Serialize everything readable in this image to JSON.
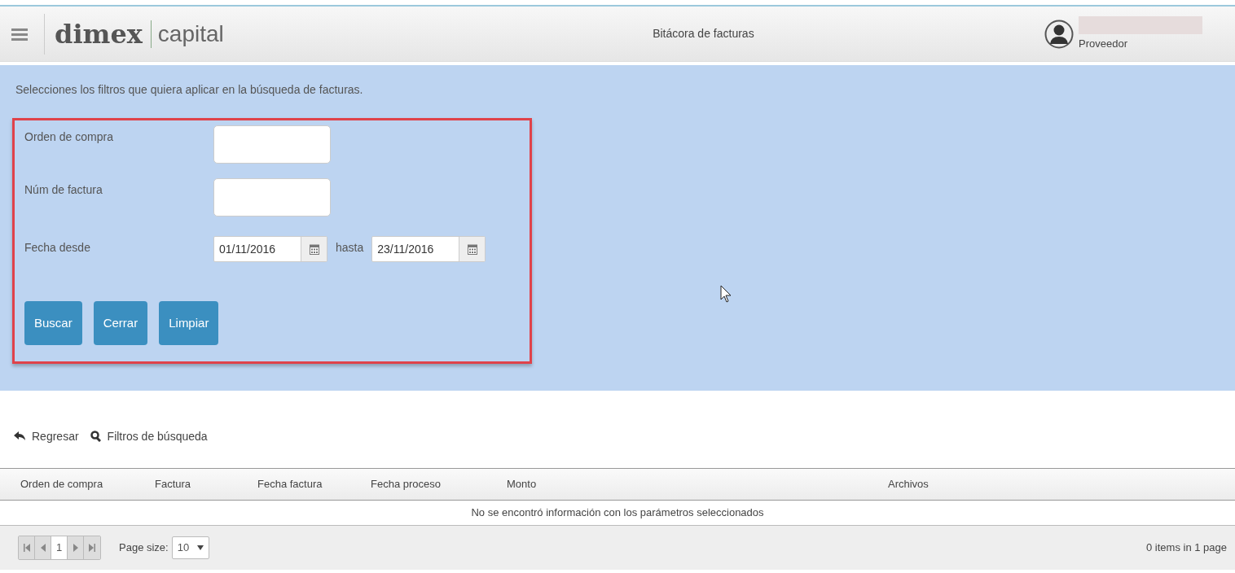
{
  "header": {
    "logo_bold": "dimex",
    "logo_light": "capital",
    "title": "Bitácora de facturas",
    "user_role": "Proveedor"
  },
  "filters": {
    "instruction": "Selecciones los filtros que quiera aplicar en la búsqueda de facturas.",
    "fields": [
      {
        "kind": "text",
        "label": "Orden de compra"
      },
      {
        "kind": "text",
        "label": "Núm de factura"
      },
      {
        "kind": "daterange",
        "label": "Fecha desde",
        "from": "01/11/2016",
        "separator": "hasta",
        "to": "23/11/2016"
      }
    ],
    "buttons": [
      "Buscar",
      "Cerrar",
      "Limpiar"
    ]
  },
  "toolbar": [
    {
      "kind": "back",
      "label": "Regresar"
    },
    {
      "kind": "search",
      "label": "Filtros de búsqueda"
    }
  ],
  "table": {
    "columns": [
      "Orden de compra",
      "Factura",
      "Fecha factura",
      "Fecha proceso",
      "Monto",
      "Archivos"
    ],
    "empty_message": "No se encontró información con los parámetros seleccionados"
  },
  "pager": {
    "page": "1",
    "page_size_label": "Page size:",
    "page_size": "10",
    "summary": "0 items in 1 page"
  }
}
